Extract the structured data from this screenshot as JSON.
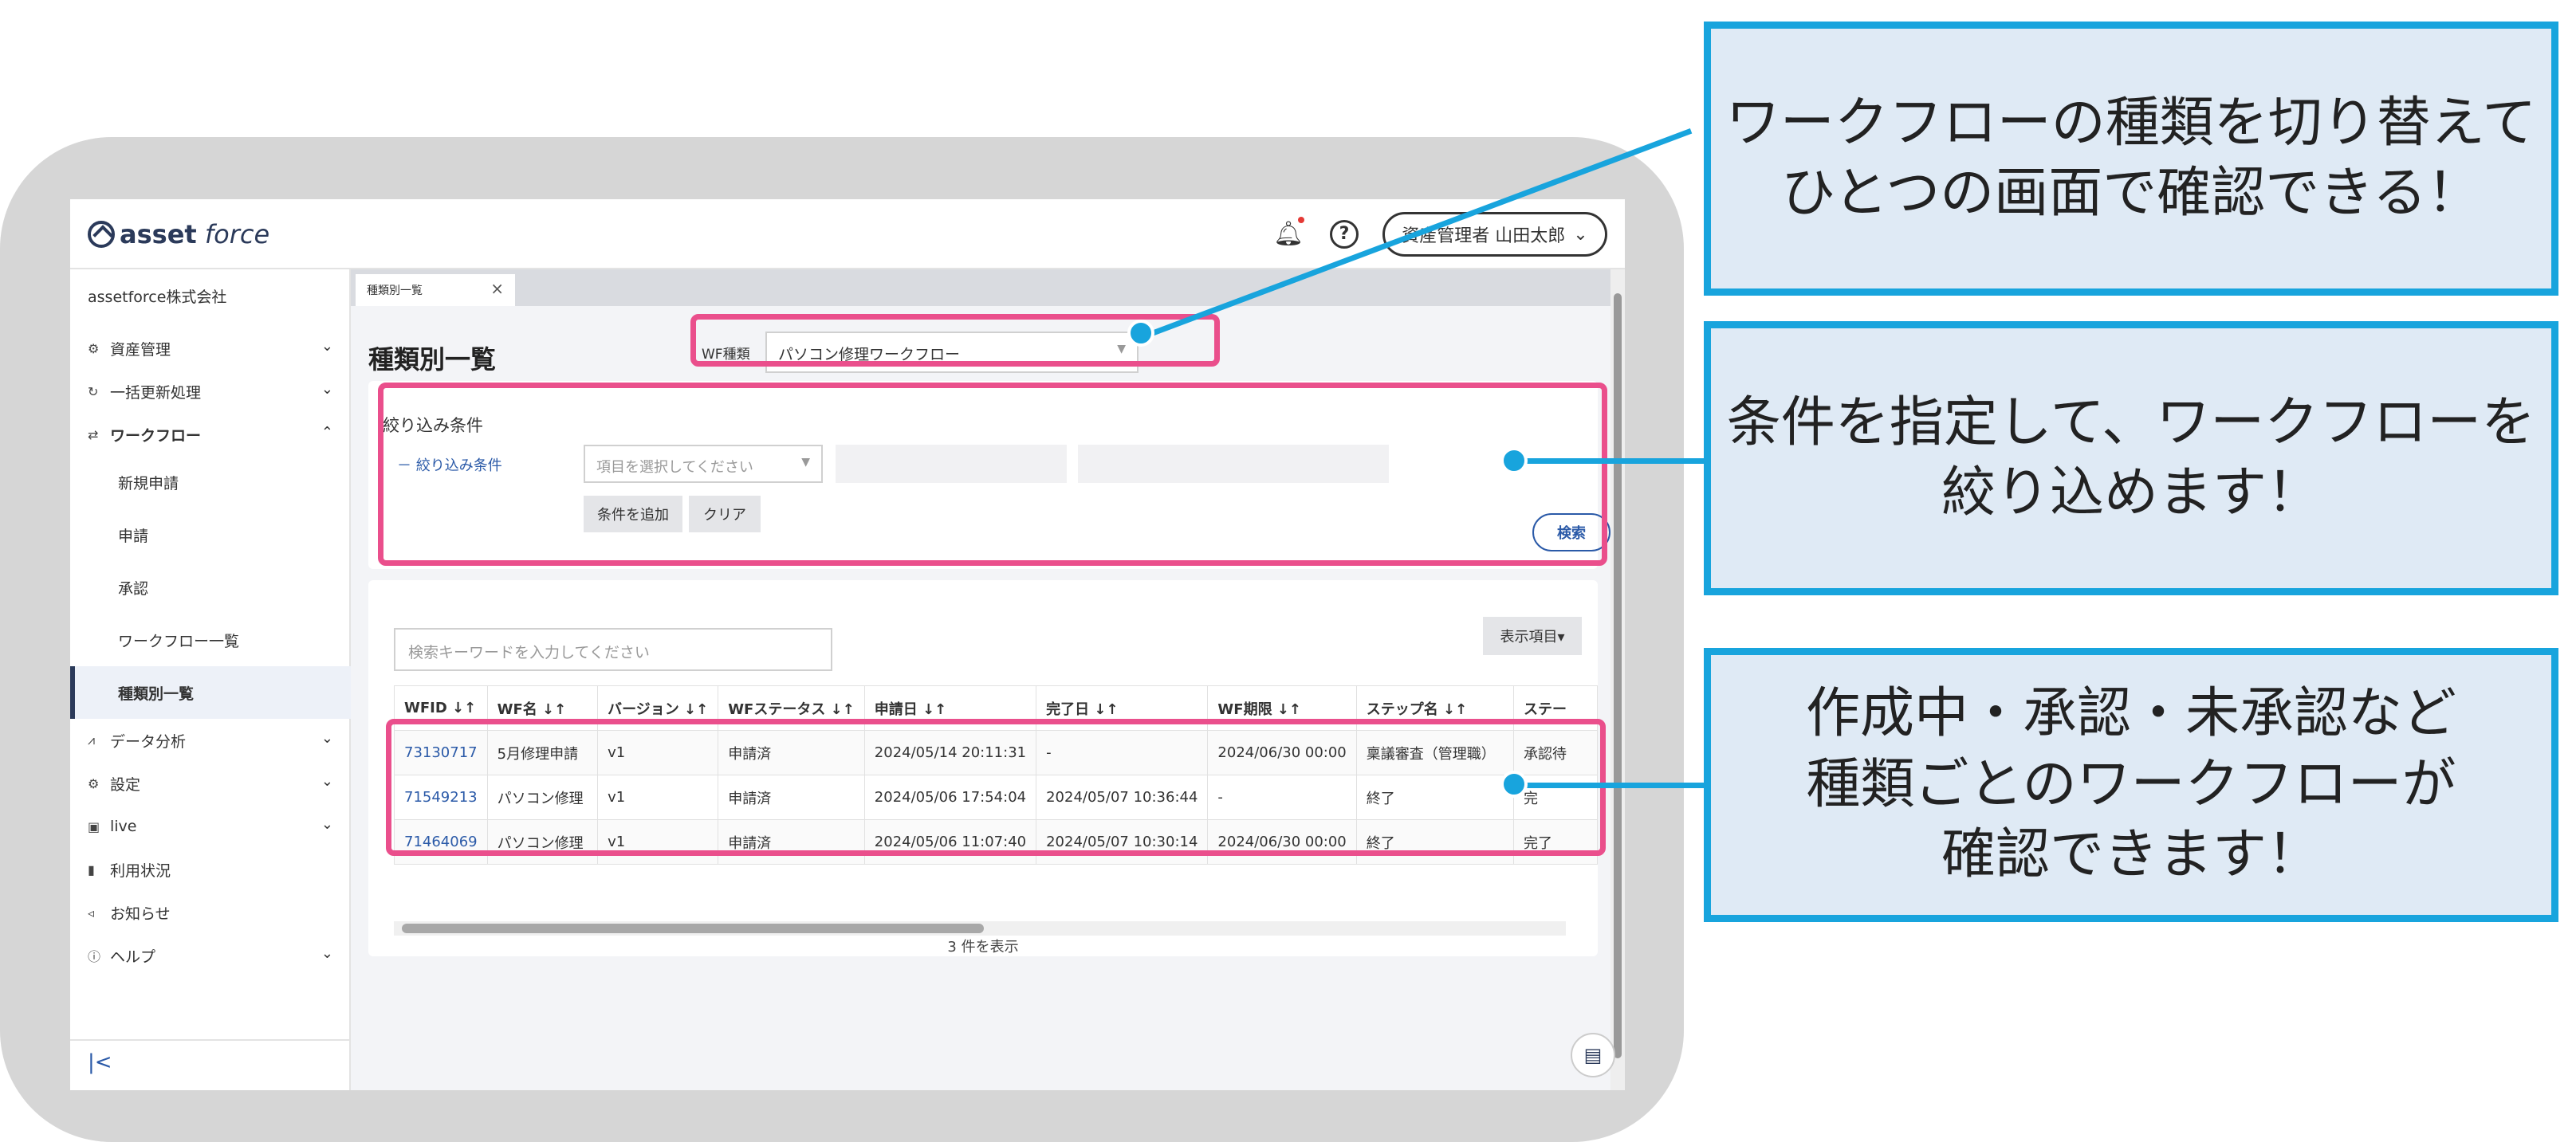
{
  "header": {
    "logo_brand": "asset",
    "logo_suffix": "force",
    "user": "資産管理者 山田太郎"
  },
  "sidebar": {
    "company": "assetforce株式会社",
    "items": [
      {
        "label": "資産管理",
        "icon": "gear-icon"
      },
      {
        "label": "一括更新処理",
        "icon": "refresh-icon"
      },
      {
        "label": "ワークフロー",
        "icon": "workflow-icon"
      }
    ],
    "workflow_sub": [
      "新規申請",
      "申請",
      "承認",
      "ワークフロー一覧",
      "種類別一覧"
    ],
    "items_after": [
      {
        "label": "データ分析",
        "icon": "chart-icon",
        "chevron": true
      },
      {
        "label": "設定",
        "icon": "settings-icon",
        "chevron": true
      },
      {
        "label": "live",
        "icon": "live-icon",
        "chevron": true
      },
      {
        "label": "利用状況",
        "icon": "usage-icon",
        "chevron": false
      },
      {
        "label": "お知らせ",
        "icon": "megaphone-icon",
        "chevron": false
      },
      {
        "label": "ヘルプ",
        "icon": "help-icon",
        "chevron": true
      }
    ],
    "collapse": "|<"
  },
  "tab": {
    "label": "種類別一覧"
  },
  "page": {
    "title": "種類別一覧",
    "wf_type_label": "WF種類",
    "wf_type_value": "パソコン修理ワークフロー"
  },
  "filter": {
    "title": "絞り込み条件",
    "link": "－ 絞り込み条件",
    "item_placeholder": "項目を選択してください",
    "add_button": "条件を追加",
    "clear_button": "クリア",
    "search_button": "検索"
  },
  "list": {
    "keyword_placeholder": "検索キーワードを入力してください",
    "columns_button": "表示項目▾",
    "columns": [
      "WFID ↓↑",
      "WF名 ↓↑",
      "バージョン ↓↑",
      "WFステータス ↓↑",
      "申請日 ↓↑",
      "完了日 ↓↑",
      "WF期限 ↓↑",
      "ステップ名 ↓↑",
      "ステー"
    ],
    "rows": [
      [
        "73130717",
        "5月修理申請",
        "v1",
        "申請済",
        "2024/05/14 20:11:31",
        "-",
        "2024/06/30 00:00",
        "稟議審査（管理職）",
        "承認待"
      ],
      [
        "71549213",
        "パソコン修理",
        "v1",
        "申請済",
        "2024/05/06 17:54:04",
        "2024/05/07 10:36:44",
        "-",
        "終了",
        "完"
      ],
      [
        "71464069",
        "パソコン修理",
        "v1",
        "申請済",
        "2024/05/06 11:07:40",
        "2024/05/07 10:30:14",
        "2024/06/30 00:00",
        "終了",
        "完了"
      ]
    ],
    "count": "3 件を表示"
  },
  "callouts": [
    {
      "lines": [
        "ワークフローの種類を切り替えて",
        "ひとつの画面で確認できる！"
      ]
    },
    {
      "lines": [
        "条件を指定して、ワークフローを",
        "絞り込めます！"
      ]
    },
    {
      "lines": [
        "作成中・承認・未承認など",
        "種類ごとのワークフローが",
        "確認できます！"
      ]
    }
  ],
  "colors": {
    "highlight": "#ea4f8c",
    "callout_border": "#18a4dd",
    "callout_fill": "#dfeaf5",
    "link": "#2b5aa8"
  }
}
